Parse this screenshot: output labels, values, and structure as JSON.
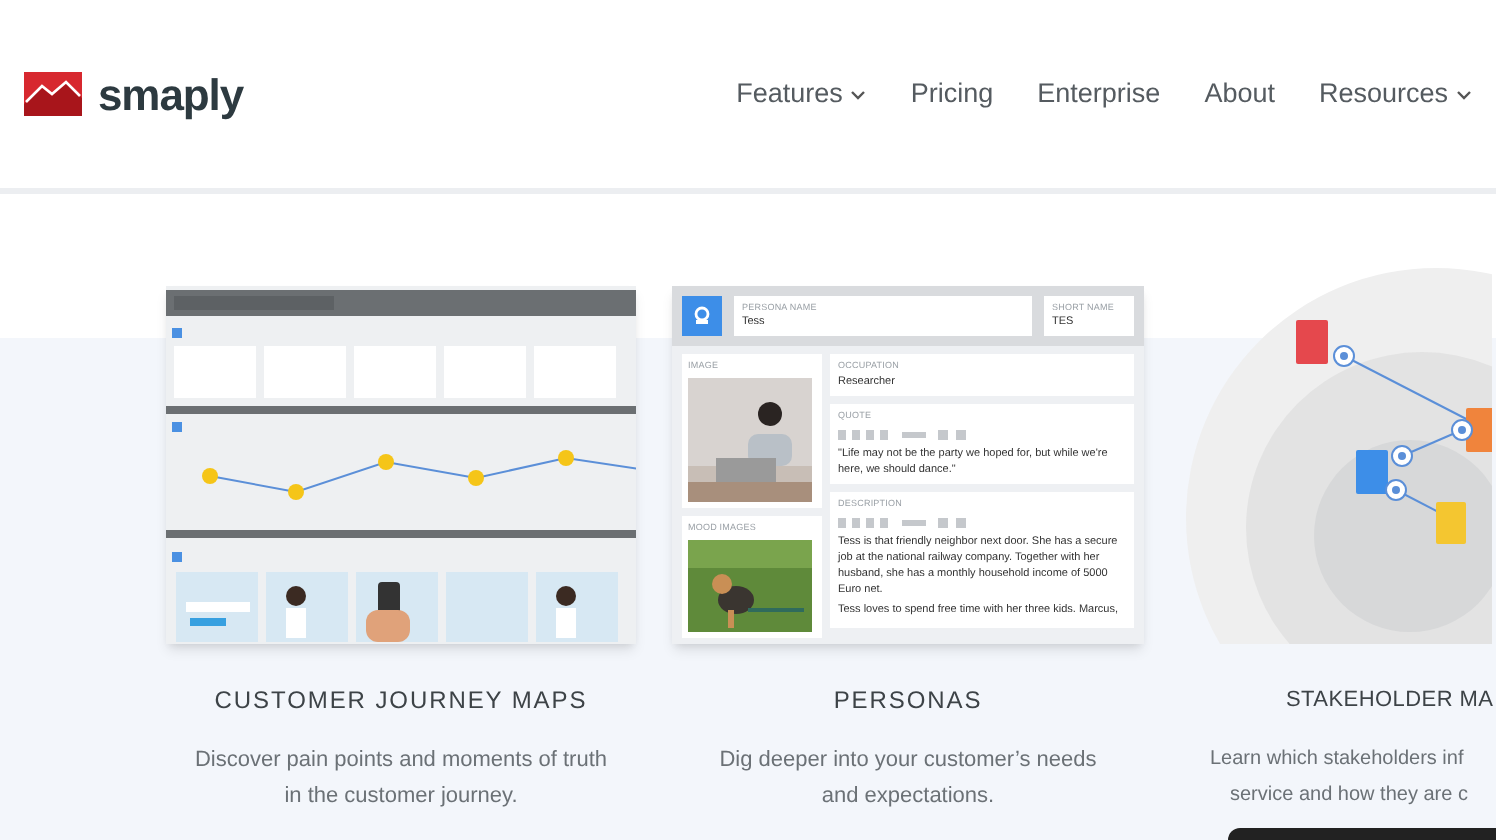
{
  "header": {
    "logo_text": "smaply",
    "nav": [
      {
        "label": "Features",
        "dropdown": true
      },
      {
        "label": "Pricing",
        "dropdown": false
      },
      {
        "label": "Enterprise",
        "dropdown": false
      },
      {
        "label": "About",
        "dropdown": false
      },
      {
        "label": "Resources",
        "dropdown": true
      }
    ]
  },
  "features": [
    {
      "kind": "journey",
      "title": "CUSTOMER JOURNEY MAPS",
      "lines": [
        "Discover pain points and moments of truth",
        "in the customer journey."
      ]
    },
    {
      "kind": "persona",
      "title": "PERSONAS",
      "lines": [
        "Dig deeper into your customer’s needs",
        "and expectations."
      ],
      "persona": {
        "name_label": "PERSONA NAME",
        "name": "Tess",
        "short_name_label": "SHORT NAME",
        "short_name": "TES",
        "image_label": "IMAGE",
        "mood_label": "MOOD IMAGES",
        "occupation_label": "OCCUPATION",
        "occupation": "Researcher",
        "quote_label": "QUOTE",
        "quote": "\"Life may not be the party we hoped for, but while we're here, we should dance.\"",
        "description_label": "DESCRIPTION",
        "description": [
          "Tess is that friendly neighbor next door. She has a secure job at the national railway company. Together with her husband, she has a monthly household income of  5000 Euro net.",
          "Tess loves to spend free time with her three kids. Marcus,"
        ]
      }
    },
    {
      "kind": "stakeholder",
      "title": "STAKEHOLDER MA",
      "lines": [
        "Learn which stakeholders inf",
        "service and how they are c"
      ]
    }
  ]
}
